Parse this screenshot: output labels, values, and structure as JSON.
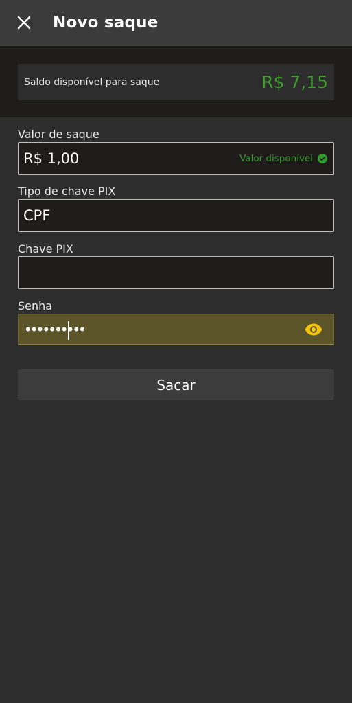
{
  "header": {
    "title": "Novo saque",
    "close_icon": "close-icon"
  },
  "balance": {
    "label": "Saldo disponível para saque",
    "value": "R$ 7,15",
    "value_color": "#3f9c2e"
  },
  "form": {
    "amount": {
      "label": "Valor de saque",
      "value": "R$ 1,00",
      "status": "Valor disponível",
      "status_icon": "check-circle-icon",
      "status_color": "#2f9b28"
    },
    "pix_key_type": {
      "label": "Tipo de chave PIX",
      "value": "CPF"
    },
    "pix_key": {
      "label": "Chave PIX",
      "value": ""
    },
    "password": {
      "label": "Senha",
      "value": "••••••••••",
      "visibility_icon": "eye-icon",
      "focus_color": "#5c5529"
    }
  },
  "actions": {
    "submit_label": "Sacar"
  }
}
